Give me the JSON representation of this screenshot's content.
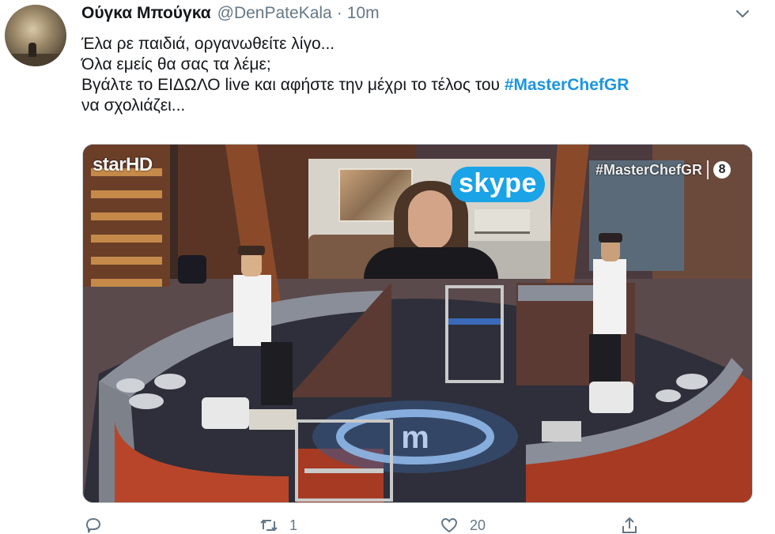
{
  "tweet": {
    "author_name": "Ούγκα Μπούγκα",
    "handle": "@DenPateKala",
    "separator": "·",
    "time": "10m",
    "lines": [
      "Έλα ρε παιδιά, οργανωθείτε λίγο...",
      "Όλα εμείς θα σας τα λέμε;",
      "Βγάλτε το ΕΙΔΩΛΟ live και αφήστε την μέχρι το τέλος του",
      "να σχολιάζει..."
    ],
    "hashtag": "#MasterChefGR"
  },
  "media": {
    "channel_logo": "starHD",
    "video_app_logo": "skype",
    "hashtag_overlay": "#MasterChefGR",
    "rating_badge": "8"
  },
  "actions": {
    "reply_icon": "reply-icon",
    "retweet_icon": "retweet-icon",
    "retweet_count": "1",
    "like_icon": "heart-icon",
    "like_count": "20",
    "share_icon": "share-icon"
  },
  "colors": {
    "link": "#1b95e0",
    "secondary_text": "#657786",
    "primary_text": "#14171a"
  }
}
